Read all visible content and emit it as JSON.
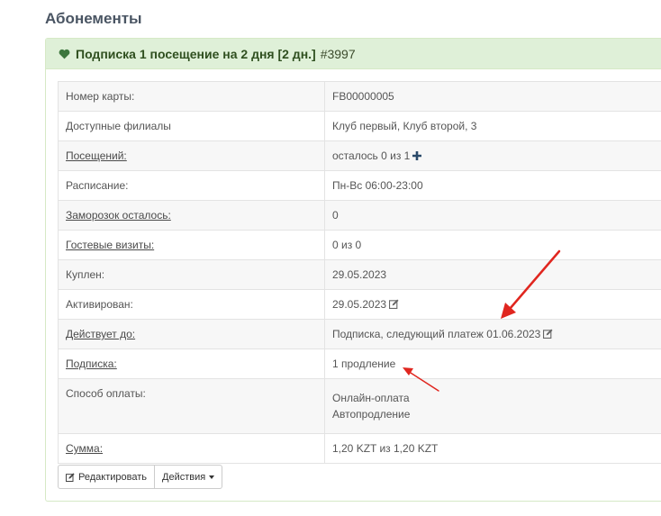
{
  "section": {
    "title": "Абонементы"
  },
  "panel": {
    "heading_title": "Подписка 1 посещение на 2 дня [2 дн.]",
    "heading_id": "#3997",
    "accent_color": "#dff0d8"
  },
  "rows": [
    {
      "label": "Номер карты:",
      "value": "FB00000005"
    },
    {
      "label": "Доступные филиалы",
      "value": "Клуб первый, Клуб второй, 3"
    },
    {
      "label": "Посещений:",
      "value": "осталось 0 из 1"
    },
    {
      "label": "Расписание:",
      "value": "Пн-Вс 06:00-23:00"
    },
    {
      "label": "Заморозок осталось:",
      "value": "0"
    },
    {
      "label": "Гостевые визиты:",
      "value": "0 из 0"
    },
    {
      "label": "Куплен:",
      "value": "29.05.2023"
    },
    {
      "label": "Активирован:",
      "value": "29.05.2023"
    },
    {
      "label": "Действует до:",
      "value": "Подписка, следующий платеж 01.06.2023"
    },
    {
      "label": "Подписка:",
      "value": "1 продление"
    },
    {
      "label": "Способ оплаты:",
      "value_line1": "Онлайн-оплата",
      "value_line2": "Автопродление"
    },
    {
      "label": "Сумма:",
      "value": "1,20 KZT из 1,20 KZT"
    }
  ],
  "buttons": {
    "edit": "Редактировать",
    "actions": "Действия"
  },
  "annotation_color": "#e0261f"
}
